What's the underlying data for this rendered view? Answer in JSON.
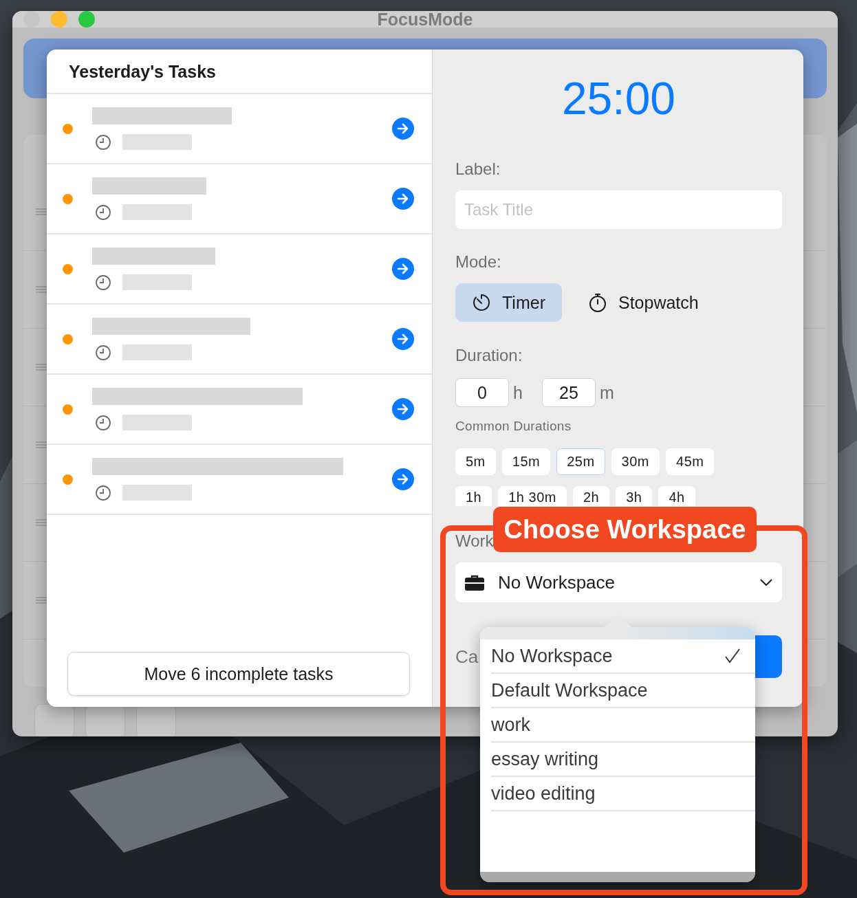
{
  "window": {
    "title": "FocusMode"
  },
  "tasks_panel": {
    "title": "Yesterday's Tasks",
    "tasks": [
      {
        "kind": "redacted"
      },
      {
        "kind": "redacted"
      },
      {
        "kind": "redacted"
      },
      {
        "kind": "redacted"
      },
      {
        "kind": "redacted"
      },
      {
        "kind": "redacted"
      }
    ],
    "move_button": "Move 6 incomplete tasks"
  },
  "timer_panel": {
    "display": "25:00",
    "label_caption": "Label:",
    "label_placeholder": "Task Title",
    "mode_caption": "Mode:",
    "modes": [
      {
        "kind": "timer",
        "label": "Timer",
        "selected": true
      },
      {
        "kind": "stopwatch",
        "label": "Stopwatch",
        "selected": false
      }
    ],
    "duration_caption": "Duration:",
    "hours": "0",
    "hours_unit": "h",
    "minutes": "25",
    "minutes_unit": "m",
    "common_caption": "Common Durations",
    "common_rows": [
      [
        {
          "label": "5m",
          "selected": false
        },
        {
          "label": "15m",
          "selected": false
        },
        {
          "label": "25m",
          "selected": true
        },
        {
          "label": "30m",
          "selected": false
        },
        {
          "label": "45m",
          "selected": false
        }
      ],
      [
        {
          "label": "1h",
          "selected": false
        },
        {
          "label": "1h 30m",
          "selected": false
        },
        {
          "label": "2h",
          "selected": false
        },
        {
          "label": "3h",
          "selected": false
        },
        {
          "label": "4h",
          "selected": false
        }
      ]
    ],
    "workspace_caption": "Work",
    "workspace_value": "No Workspace",
    "cancel_partial": "Ca"
  },
  "workspace_menu": {
    "options": [
      {
        "label": "No Workspace",
        "selected": true
      },
      {
        "label": "Default Workspace",
        "selected": false
      },
      {
        "label": "work",
        "selected": false
      },
      {
        "label": "essay writing",
        "selected": false
      },
      {
        "label": "video editing",
        "selected": false
      }
    ]
  },
  "callout": {
    "label": "Choose Workspace"
  }
}
